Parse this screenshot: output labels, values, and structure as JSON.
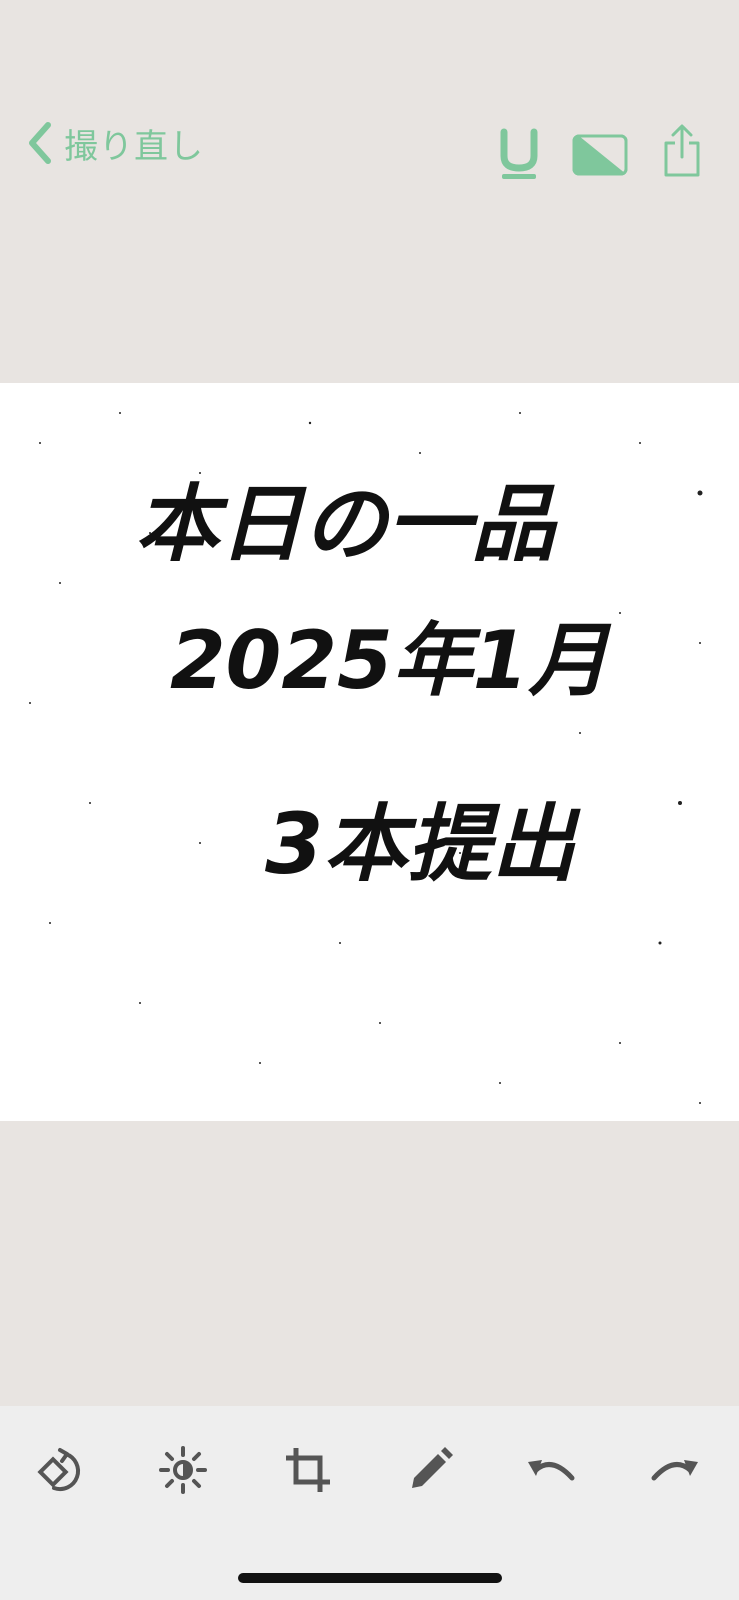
{
  "header": {
    "back_label": "撮り直し"
  },
  "icons": {
    "back": "chevron-left-icon",
    "underline": "underline-icon",
    "contrast": "contrast-filter-icon",
    "share": "share-icon",
    "rotate": "rotate-icon",
    "brightness": "brightness-icon",
    "crop": "crop-icon",
    "pen": "pen-icon",
    "undo": "undo-icon",
    "redo": "redo-icon"
  },
  "colors": {
    "accent": "#7fc79c",
    "background": "#e8e4e1",
    "toolbar": "#eeeeee",
    "tool_icon": "#555555"
  },
  "document": {
    "lines": [
      "本日の一品",
      "2025年1月",
      "3本提出"
    ]
  }
}
